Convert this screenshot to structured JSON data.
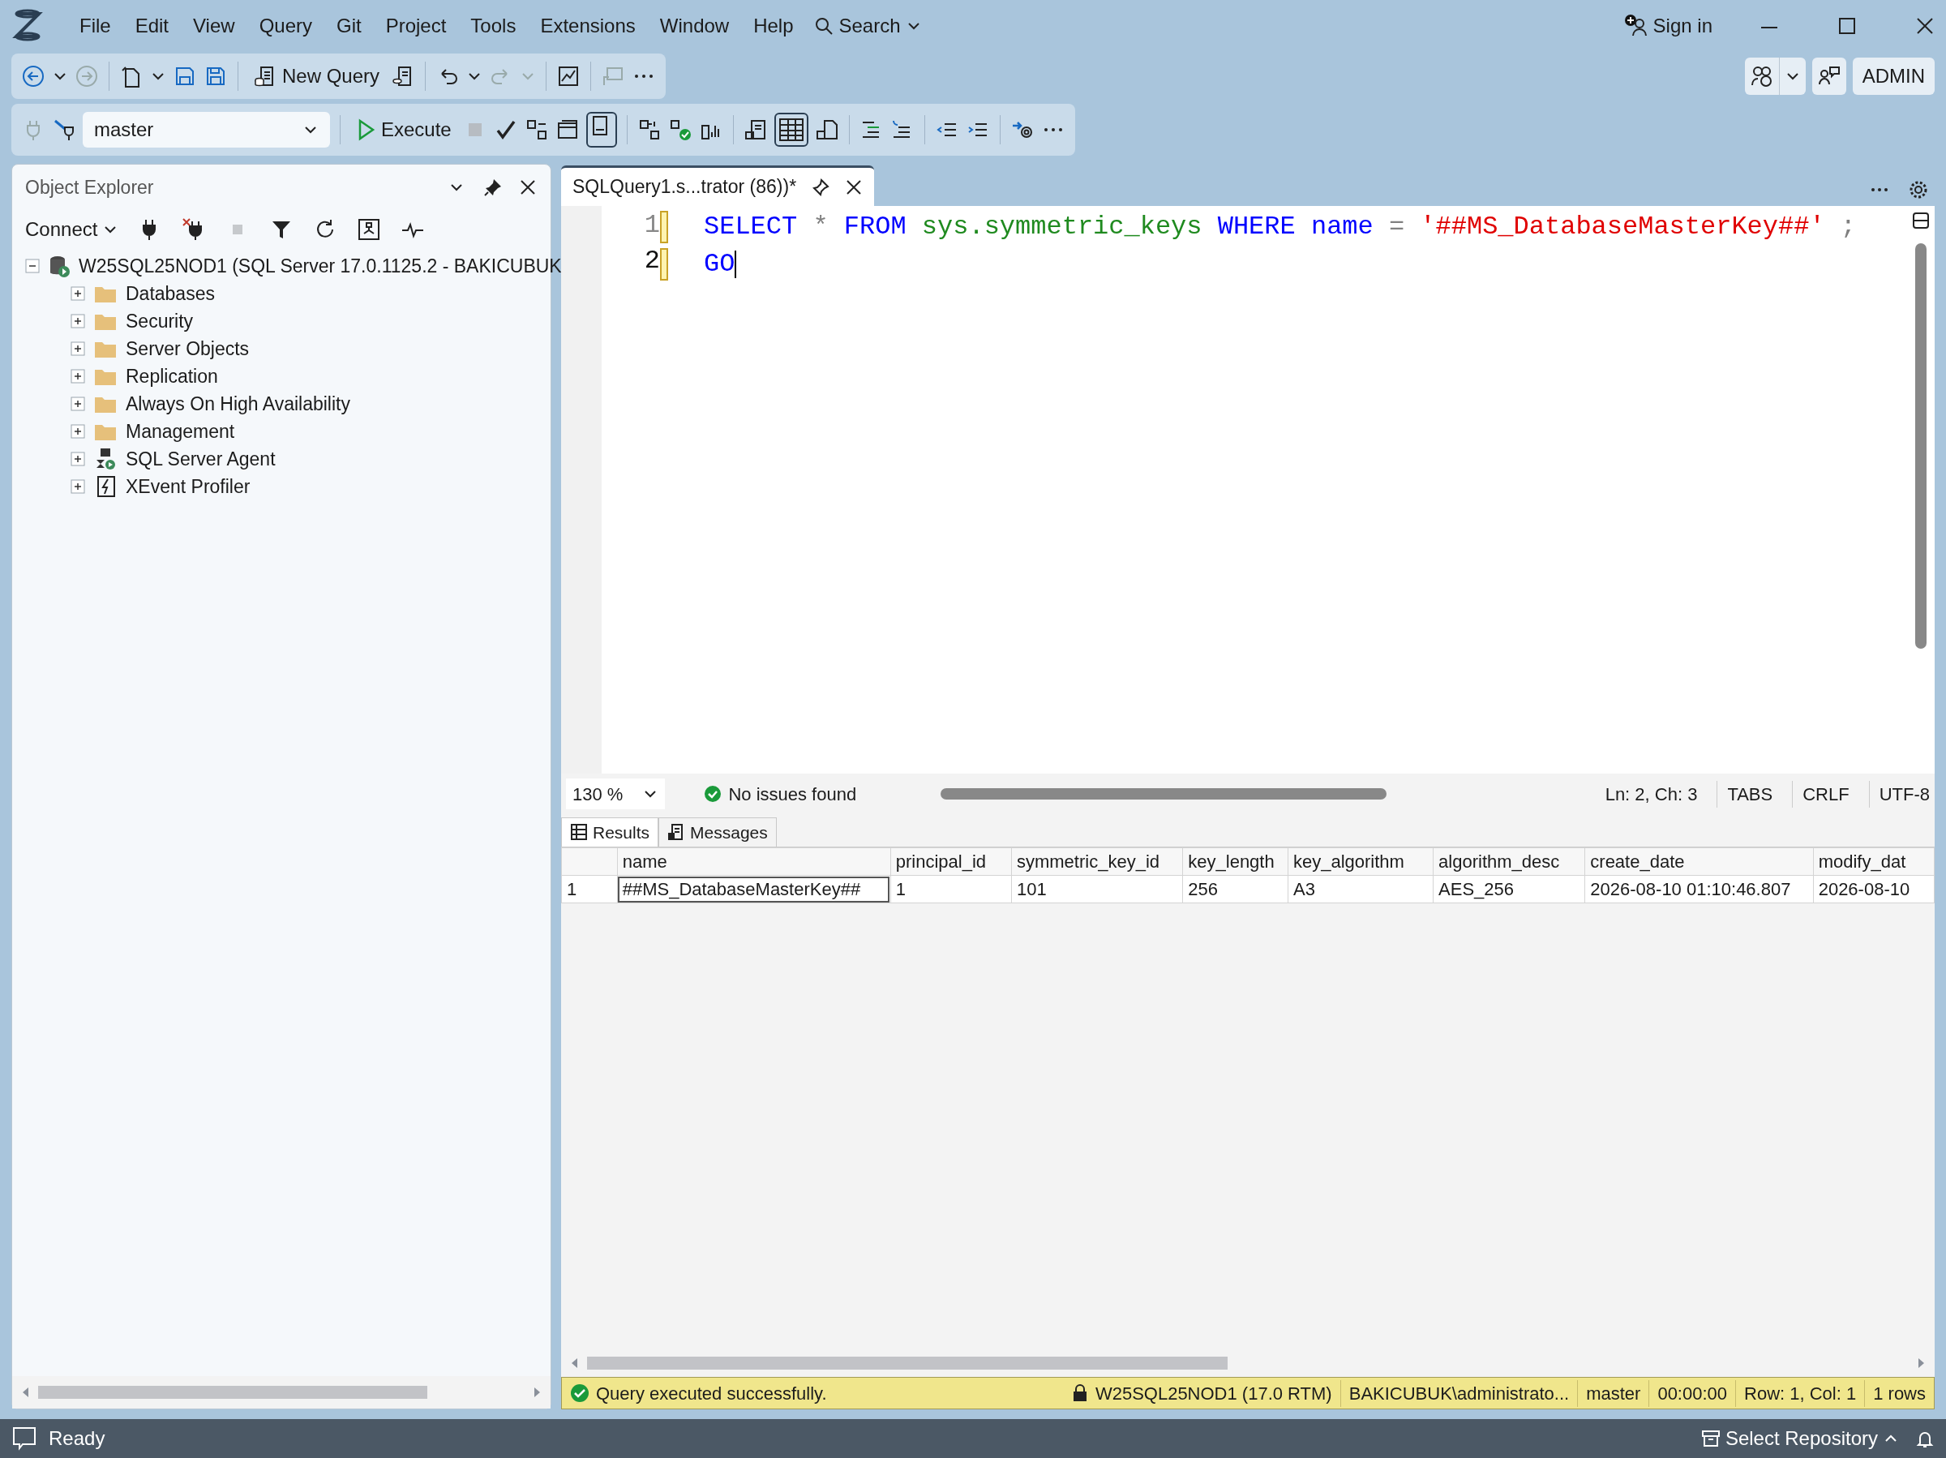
{
  "menu": [
    "File",
    "Edit",
    "View",
    "Query",
    "Git",
    "Project",
    "Tools",
    "Extensions",
    "Window",
    "Help"
  ],
  "search": "Search",
  "sign_in": "Sign in",
  "account": "ADMIN",
  "toolbar": {
    "new_query": "New Query",
    "database": "master",
    "execute": "Execute"
  },
  "object_explorer": {
    "title": "Object Explorer",
    "connect": "Connect",
    "tree": [
      {
        "label": "W25SQL25NOD1 (SQL Server 17.0.1125.2 - BAKICUBUK",
        "kind": "server",
        "expanded": true,
        "children": [
          {
            "label": "Databases",
            "kind": "folder",
            "expanded": false
          },
          {
            "label": "Security",
            "kind": "folder",
            "expanded": false
          },
          {
            "label": "Server Objects",
            "kind": "folder",
            "expanded": false
          },
          {
            "label": "Replication",
            "kind": "folder",
            "expanded": false
          },
          {
            "label": "Always On High Availability",
            "kind": "folder",
            "expanded": false
          },
          {
            "label": "Management",
            "kind": "folder",
            "expanded": false
          },
          {
            "label": "SQL Server Agent",
            "kind": "agent",
            "expanded": false
          },
          {
            "label": "XEvent Profiler",
            "kind": "profiler",
            "expanded": false
          }
        ]
      }
    ]
  },
  "document_tab": {
    "title": "SQLQuery1.s...trator (86))*"
  },
  "editor": {
    "lines": [
      {
        "number": "1",
        "current": false,
        "tokens": [
          {
            "kind": "keyword",
            "text": "SELECT"
          },
          {
            "kind": "operator",
            "text": "*"
          },
          {
            "kind": "keyword",
            "text": "FROM"
          },
          {
            "kind": "system",
            "text": "sys.symmetric_keys"
          },
          {
            "kind": "keyword",
            "text": "WHERE"
          },
          {
            "kind": "keyword",
            "text": "name"
          },
          {
            "kind": "operator",
            "text": "="
          },
          {
            "kind": "string",
            "text": "'##MS_DatabaseMasterKey##'"
          },
          {
            "kind": "operator",
            "text": ";"
          }
        ]
      },
      {
        "number": "2",
        "current": true,
        "tokens": [
          {
            "kind": "keyword",
            "text": "GO"
          }
        ]
      }
    ]
  },
  "editor_status": {
    "zoom": "130 %",
    "issues": "No issues found",
    "position": "Ln: 2, Ch: 3",
    "indent": "TABS",
    "line_endings": "CRLF",
    "encoding": "UTF-8"
  },
  "result_tabs": [
    {
      "label": "Results",
      "selected": true
    },
    {
      "label": "Messages",
      "selected": false
    }
  ],
  "grid": {
    "columns": [
      "name",
      "principal_id",
      "symmetric_key_id",
      "key_length",
      "key_algorithm",
      "algorithm_desc",
      "create_date",
      "modify_dat"
    ],
    "rows": [
      {
        "number": "1",
        "cells": [
          {
            "text": "##MS_DatabaseMasterKey##",
            "selected": true
          },
          {
            "text": "1",
            "selected": false
          },
          {
            "text": "101",
            "selected": false
          },
          {
            "text": "256",
            "selected": false
          },
          {
            "text": "A3",
            "selected": false
          },
          {
            "text": "AES_256",
            "selected": false
          },
          {
            "text": "2026-08-10 01:10:46.807",
            "selected": false
          },
          {
            "text": "2026-08-10",
            "selected": false
          }
        ]
      }
    ]
  },
  "query_status": {
    "message": "Query executed successfully.",
    "server": "W25SQL25NOD1 (17.0 RTM)",
    "user": "BAKICUBUK\\administrato...",
    "database": "master",
    "elapsed": "00:00:00",
    "position": "Row: 1, Col: 1",
    "rows": "1 rows"
  },
  "status_bar": {
    "text": "Ready",
    "repository": "Select Repository"
  }
}
